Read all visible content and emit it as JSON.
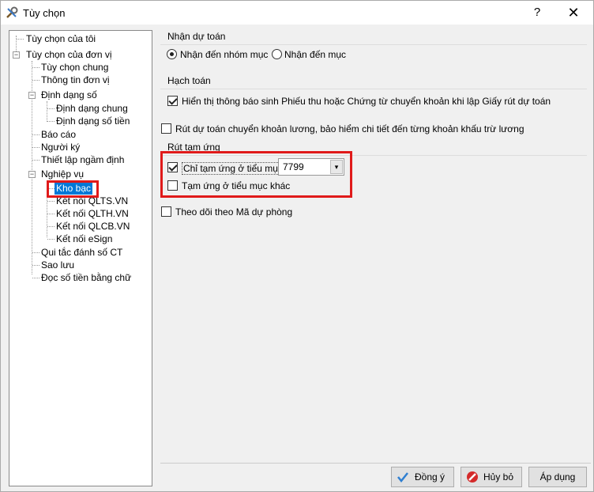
{
  "window": {
    "title": "Tùy chọn",
    "help": "?",
    "close": "✕"
  },
  "tree": {
    "items": [
      "Tùy chọn của tôi",
      "Tùy chọn của đơn vị",
      "Tùy chọn chung",
      "Thông tin đơn vị",
      "Định dạng số",
      "Định dạng chung",
      "Định dạng số tiền",
      "Báo cáo",
      "Người ký",
      "Thiết lập ngầm định",
      "Nghiệp vụ",
      "Kho bạc",
      "Kết nối QLTS.VN",
      "Kết nối QLTH.VN",
      "Kết nối QLCB.VN",
      "Kết nối eSign",
      "Qui tắc đánh số CT",
      "Sao lưu",
      "Đọc số tiền bằng chữ"
    ],
    "selected": "Kho bạc"
  },
  "sections": {
    "du_toan": {
      "title": "Nhận dự toán",
      "opt1": "Nhận đến nhóm mục",
      "opt2": "Nhận đến mục",
      "selected": "Nhận đến nhóm mục"
    },
    "hach_toan": {
      "title": "Hạch toán",
      "show_notice": "Hiển thị thông báo sinh Phiếu thu hoặc Chứng từ chuyển khoản khi lập Giấy rút dự toán",
      "show_notice_checked": true,
      "detail": "Rút dự toán chuyển khoản lương, bảo hiểm chi tiết đến từng khoản khấu trừ lương",
      "detail_checked": false
    },
    "rut_tam_ung": {
      "title": "Rút tạm ứng",
      "only": "Chỉ tạm ứng ở tiểu mục",
      "only_checked": true,
      "combo_value": "7799",
      "other": "Tạm ứng ở tiểu mục khác",
      "other_checked": false
    },
    "reserve": {
      "label": "Theo dõi theo Mã dự phòng",
      "checked": false
    }
  },
  "buttons": {
    "ok": "Đồng ý",
    "cancel": "Hủy bỏ",
    "apply": "Áp dụng"
  }
}
